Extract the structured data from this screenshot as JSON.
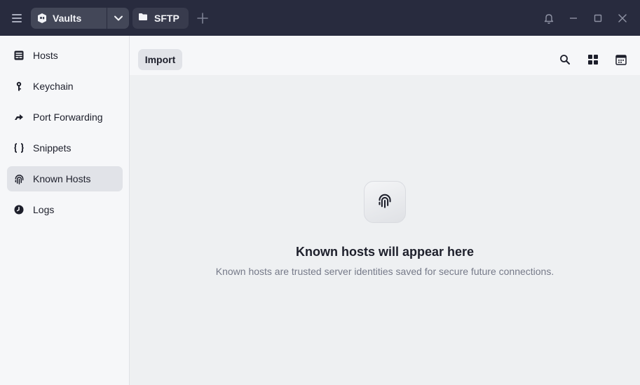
{
  "titlebar": {
    "vaults_label": "Vaults",
    "sftp_label": "SFTP",
    "icons": [
      "menu-icon",
      "vault-icon",
      "chevron-down-icon",
      "folder-icon",
      "plus-icon",
      "bell-icon",
      "minimize-icon",
      "maximize-icon",
      "close-icon"
    ]
  },
  "sidebar": {
    "items": [
      {
        "label": "Hosts",
        "icon": "hosts-icon",
        "active": false
      },
      {
        "label": "Keychain",
        "icon": "key-icon",
        "active": false
      },
      {
        "label": "Port Forwarding",
        "icon": "port-forward-icon",
        "active": false
      },
      {
        "label": "Snippets",
        "icon": "snippets-icon",
        "active": false
      },
      {
        "label": "Known Hosts",
        "icon": "fingerprint-icon",
        "active": true
      },
      {
        "label": "Logs",
        "icon": "clock-icon",
        "active": false
      }
    ]
  },
  "toolbar": {
    "import_label": "Import",
    "icons": [
      "search-icon",
      "grid-view-icon",
      "calendar-icon"
    ]
  },
  "empty_state": {
    "icon": "fingerprint-icon",
    "title": "Known hosts will appear here",
    "description": "Known hosts are trusted server identities saved for secure future connections."
  },
  "colors": {
    "titlebar_bg": "#282b3e",
    "sidebar_bg": "#f6f7f9",
    "main_bg": "#eef0f2",
    "active_item_bg": "#e1e3e8"
  }
}
